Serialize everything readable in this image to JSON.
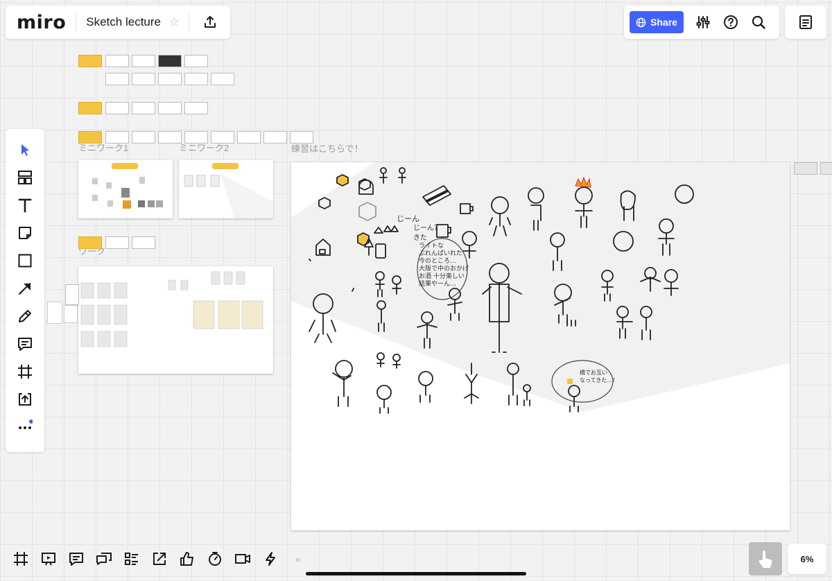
{
  "app": {
    "logo": "miro",
    "board_title": "Sketch lecture"
  },
  "header": {
    "share_label": "Share"
  },
  "canvas": {
    "frame_labels": {
      "mini_work_1": "ミニワーク1",
      "mini_work_2": "ミニワーク2",
      "practice": "練習はこちらで！",
      "work": "ワーク"
    },
    "handwritten": {
      "jiin": "じーん",
      "jiin2": "じーん？",
      "kita": "きた",
      "line1": "ライトな",
      "line2": "ぶれんぱいれた",
      "line3": "今のところ…",
      "line4": "大阪で中のおかげ",
      "line5": "お酒 十分楽しい",
      "line6": "結果やーん…",
      "bubble1": "橋でお互い",
      "bubble2": "なってきた…！"
    }
  },
  "zoom": {
    "level": "6%"
  },
  "colors": {
    "accent": "#4262ff",
    "sticky": "#f5c342",
    "flame": "#f39c12"
  },
  "icons": [
    "cursor-icon",
    "templates-icon",
    "text-icon",
    "sticky-note-icon",
    "shape-icon",
    "arrow-icon",
    "pen-icon",
    "comment-icon",
    "frame-icon",
    "upload-icon",
    "more-icon"
  ]
}
